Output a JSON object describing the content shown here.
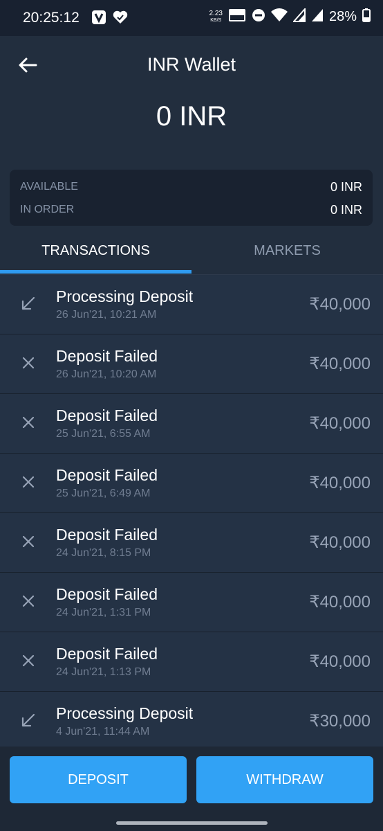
{
  "status_bar": {
    "time": "20:25:12",
    "netspeed_value": "2.23",
    "netspeed_unit": "KB/S",
    "battery": "28%",
    "icons": [
      "vpn-icon",
      "heart-check-icon",
      "volte-icon",
      "dnd-icon",
      "wifi-icon",
      "signal-icon",
      "signal-icon",
      "battery-icon"
    ]
  },
  "header": {
    "title": "INR Wallet",
    "balance": "0 INR"
  },
  "summary": {
    "available_label": "AVAILABLE",
    "available_value": "0 INR",
    "in_order_label": "IN ORDER",
    "in_order_value": "0 INR"
  },
  "tabs": [
    {
      "label": "TRANSACTIONS",
      "active": true
    },
    {
      "label": "MARKETS",
      "active": false
    }
  ],
  "transactions": [
    {
      "icon": "arrow-down-left-icon",
      "title": "Processing Deposit",
      "date": "26 Jun'21, 10:21 AM",
      "amount": "₹40,000"
    },
    {
      "icon": "cross-icon",
      "title": "Deposit Failed",
      "date": "26 Jun'21, 10:20 AM",
      "amount": "₹40,000"
    },
    {
      "icon": "cross-icon",
      "title": "Deposit Failed",
      "date": "25 Jun'21, 6:55 AM",
      "amount": "₹40,000"
    },
    {
      "icon": "cross-icon",
      "title": "Deposit Failed",
      "date": "25 Jun'21, 6:49 AM",
      "amount": "₹40,000"
    },
    {
      "icon": "cross-icon",
      "title": "Deposit Failed",
      "date": "24 Jun'21, 8:15 PM",
      "amount": "₹40,000"
    },
    {
      "icon": "cross-icon",
      "title": "Deposit Failed",
      "date": "24 Jun'21, 1:31 PM",
      "amount": "₹40,000"
    },
    {
      "icon": "cross-icon",
      "title": "Deposit Failed",
      "date": "24 Jun'21, 1:13 PM",
      "amount": "₹40,000"
    },
    {
      "icon": "arrow-down-left-icon",
      "title": "Processing Deposit",
      "date": "4 Jun'21, 11:44 AM",
      "amount": "₹30,000"
    }
  ],
  "actions": {
    "deposit_label": "DEPOSIT",
    "withdraw_label": "WITHDRAW"
  },
  "colors": {
    "accent": "#31a2f5",
    "background": "#1e2836",
    "row_background": "#243245"
  }
}
